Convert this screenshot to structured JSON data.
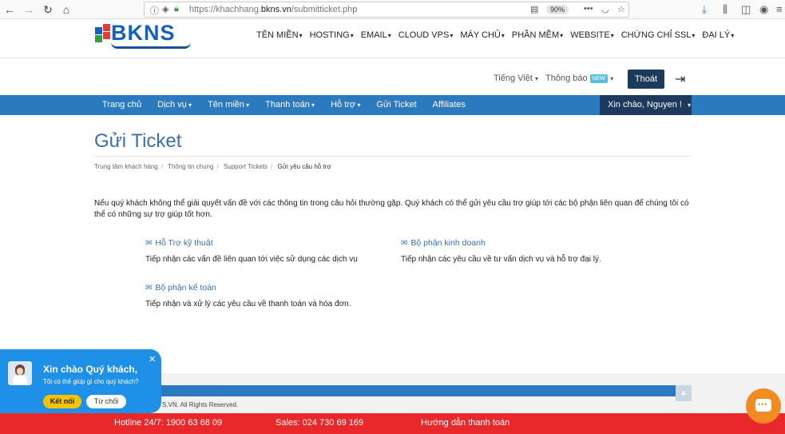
{
  "browser": {
    "url_prefix": "https://khachhang.",
    "url_domain": "bkns.vn",
    "url_suffix": "/submitticket.php",
    "zoom": "90%"
  },
  "header": {
    "logo_text": "BKNS",
    "menu": [
      "TÊN MIỀN",
      "HOSTING",
      "EMAIL",
      "CLOUD VPS",
      "MÁY CHỦ",
      "PHẦN MỀM",
      "WEBSITE",
      "CHỨNG CHỈ SSL",
      "ĐẠI LÝ"
    ],
    "language": "Tiếng Việt",
    "notifications": "Thông báo",
    "new_badge": "NEW",
    "logout": "Thoát"
  },
  "nav": {
    "items": [
      "Trang chủ",
      "Dịch vụ",
      "Tên miền",
      "Thanh toán",
      "Hỗ trợ",
      "Gửi Ticket",
      "Affiliates"
    ],
    "greeting": "Xin chào, Nguyen !"
  },
  "main": {
    "title": "Gửi Ticket",
    "breadcrumb": [
      "Trung tâm khách hàng",
      "Thông tin chung",
      "Support Tickets",
      "Gửi yêu cầu hỗ trợ"
    ],
    "intro": "Nếu quý khách không thể giải quyết vấn đề với các thông tin trong câu hỏi thường gặp. Quý khách có thể gửi yêu cầu trợ giúp tới các bộ phận liên quan để chúng tôi có thể có những sự trợ giúp tốt hơn.",
    "departments": [
      {
        "name": "Hỗ Trợ kỹ thuật",
        "desc": "Tiếp nhận các vấn đề liên quan tới việc sử dụng các dịch vụ"
      },
      {
        "name": "Bộ phận kinh doanh",
        "desc": "Tiếp nhận các yêu cầu về tư vấn dịch vụ và hỗ trợ đại lý."
      },
      {
        "name": "Bộ phận kế toán",
        "desc": "Tiếp nhận và xử lý các yêu cầu về thanh toán và hóa đơn."
      }
    ]
  },
  "footer": {
    "copyright": "S.VN. All Rights Reserved.",
    "hotline": "Hotline 24/7: 1900 63 68 09",
    "sales": "Sales: 024 730 69 169",
    "payment_guide": "Hướng dẫn thanh toán"
  },
  "chat": {
    "title": "Xin chào Quý khách,",
    "subtitle": "Tôi có thể giúp gì cho quý khách?",
    "accept": "Kết nối",
    "reject": "Từ chối"
  },
  "colors": {
    "nav_blue": "#2b7ac0",
    "dark_navy": "#1b3a5c",
    "footer_red": "#e8282b",
    "chat_blue": "#1e90e8",
    "chat_orange": "#f28b22"
  }
}
